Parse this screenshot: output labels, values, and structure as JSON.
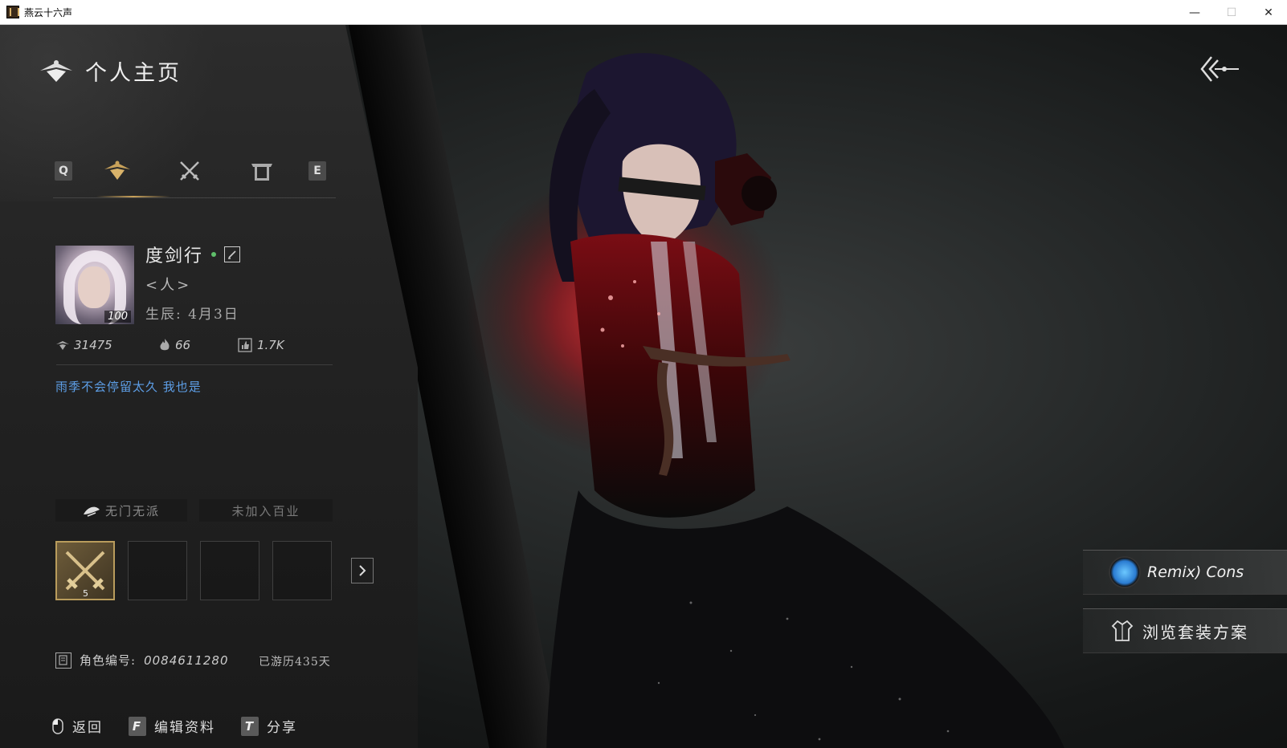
{
  "window": {
    "title": "燕云十六声",
    "minimize": "—",
    "maximize": "☐",
    "close": "✕"
  },
  "header": {
    "title": "个人主页"
  },
  "tabs": {
    "left_key": "Q",
    "right_key": "E",
    "items": [
      {
        "icon": "profile-emblem-icon",
        "active": true
      },
      {
        "icon": "crossed-swords-icon",
        "active": false
      },
      {
        "icon": "gate-icon",
        "active": false
      }
    ]
  },
  "profile": {
    "avatar_level": "100",
    "name": "度剑行",
    "title": "<人>",
    "birthday": "生辰: 4月3日",
    "stats": {
      "power": "31475",
      "popularity": "66",
      "likes": "1.7K"
    },
    "signature": "雨季不会停留太久 我也是"
  },
  "affiliation": {
    "faction": "无门无派",
    "guild": "未加入百业"
  },
  "slots": {
    "first_badge": "5"
  },
  "info": {
    "char_code_label": "角色编号:",
    "char_code_value": "0084611280",
    "days": "已游历435天"
  },
  "actions": {
    "back_label": "返回",
    "edit_key": "F",
    "edit_label": "编辑资料",
    "share_key": "T",
    "share_label": "分享"
  },
  "footer": {
    "id": "ID: 0084611280"
  },
  "right_panel": {
    "music_label": "Remix) Cons",
    "outfit_label": "浏览套装方案"
  },
  "colors": {
    "accent_gold": "#c9a25a",
    "signature_blue": "#5d9ee6",
    "online_green": "#5fbf6a"
  }
}
